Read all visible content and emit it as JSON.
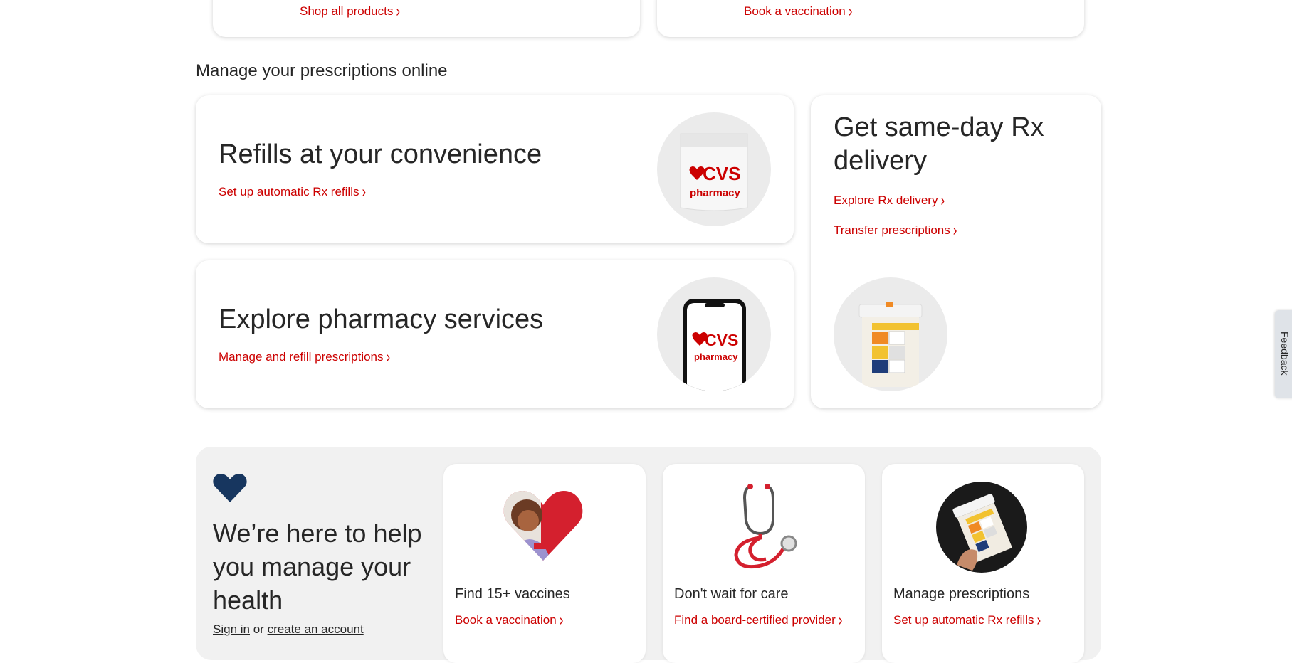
{
  "top_cards": [
    {
      "link": "Shop all products"
    },
    {
      "link": "Book a vaccination"
    }
  ],
  "manage_section": {
    "title": "Manage your prescriptions online",
    "refills": {
      "heading": "Refills at your convenience",
      "link": "Set up automatic Rx refills",
      "image_text": [
        "CVS",
        "pharmacy"
      ]
    },
    "services": {
      "heading": "Explore pharmacy services",
      "link": "Manage and refill prescriptions",
      "image_text": [
        "CVS",
        "pharmacy"
      ]
    },
    "delivery": {
      "heading": "Get same-day Rx delivery",
      "links": [
        "Explore Rx delivery",
        "Transfer prescriptions"
      ]
    }
  },
  "help_section": {
    "title": "We’re here to help you manage your health",
    "sign_in": "Sign in",
    "or_text": "or",
    "create_account": "create an account",
    "cards": [
      {
        "title": "Find 15+ vaccines",
        "link": "Book a vaccination"
      },
      {
        "title": "Don't wait for care",
        "link": "Find a board-certified provider"
      },
      {
        "title": "Manage prescriptions",
        "link": "Set up automatic Rx refills"
      }
    ]
  },
  "feedback_tab": "Feedback",
  "colors": {
    "brand_red": "#cc0000",
    "navy": "#17365f",
    "panel_gray": "#f1f1f1"
  }
}
